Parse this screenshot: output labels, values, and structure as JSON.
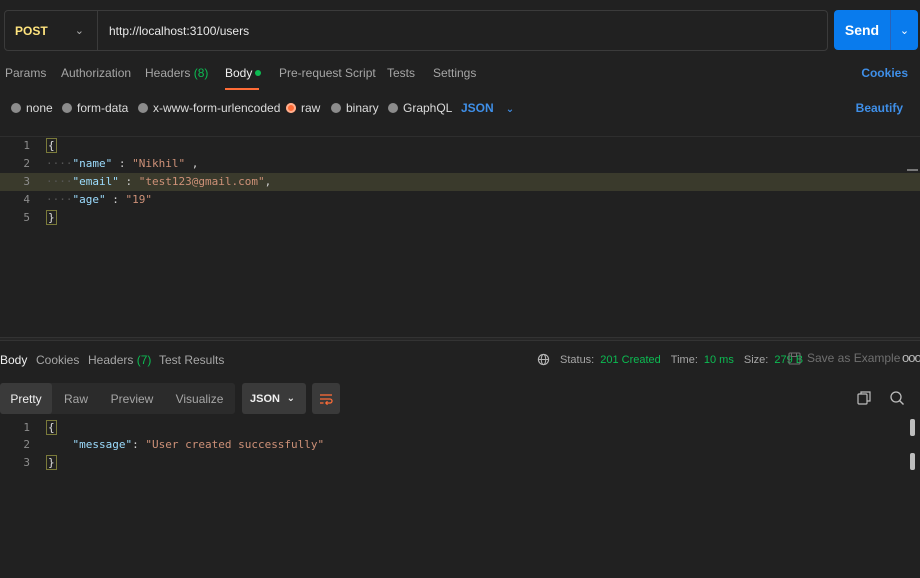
{
  "request": {
    "method": "POST",
    "url": "http://localhost:3100/users",
    "send_label": "Send"
  },
  "request_tabs": [
    {
      "label": "Params"
    },
    {
      "label": "Authorization"
    },
    {
      "label": "Headers",
      "count": "(8)"
    },
    {
      "label": "Body"
    },
    {
      "label": "Pre-request Script"
    },
    {
      "label": "Tests"
    },
    {
      "label": "Settings"
    }
  ],
  "cookies_label": "Cookies",
  "body_types": [
    "none",
    "form-data",
    "x-www-form-urlencoded",
    "raw",
    "binary",
    "GraphQL"
  ],
  "body_type_selected": "raw",
  "raw_format": "JSON",
  "beautify_label": "Beautify",
  "request_body": {
    "line_numbers": [
      "1",
      "2",
      "3",
      "4",
      "5"
    ],
    "open": "{",
    "close": "}",
    "fields": [
      {
        "key": "\"name\"",
        "sep": " : ",
        "value": "\"Nikhil\"",
        "trail": " ,"
      },
      {
        "key": "\"email\"",
        "sep": " : ",
        "value": "\"test123@gmail.com\"",
        "trail": ","
      },
      {
        "key": "\"age\"",
        "sep": " : ",
        "value": "\"19\"",
        "trail": ""
      }
    ]
  },
  "response_tabs": [
    {
      "label": "Body"
    },
    {
      "label": "Cookies"
    },
    {
      "label": "Headers",
      "count": "(7)"
    },
    {
      "label": "Test Results"
    }
  ],
  "status": {
    "status_label": "Status:",
    "status_value": "201 Created",
    "time_label": "Time:",
    "time_value": "10 ms",
    "size_label": "Size:",
    "size_value": "279 B"
  },
  "save_example_label": "Save as Example",
  "more_label": "ooo",
  "view_modes": [
    "Pretty",
    "Raw",
    "Preview",
    "Visualize"
  ],
  "response_format": "JSON",
  "response_body": {
    "line_numbers": [
      "1",
      "2",
      "3"
    ],
    "open": "{",
    "close": "}",
    "key": "\"message\"",
    "sep": ": ",
    "value": "\"User created successfully\""
  },
  "colors": {
    "accent_orange": "#ff6c37",
    "send_blue": "#097bed",
    "link_blue": "#3f8fe8",
    "success_green": "#0cbb52",
    "method_yellow": "#ffe47e"
  }
}
